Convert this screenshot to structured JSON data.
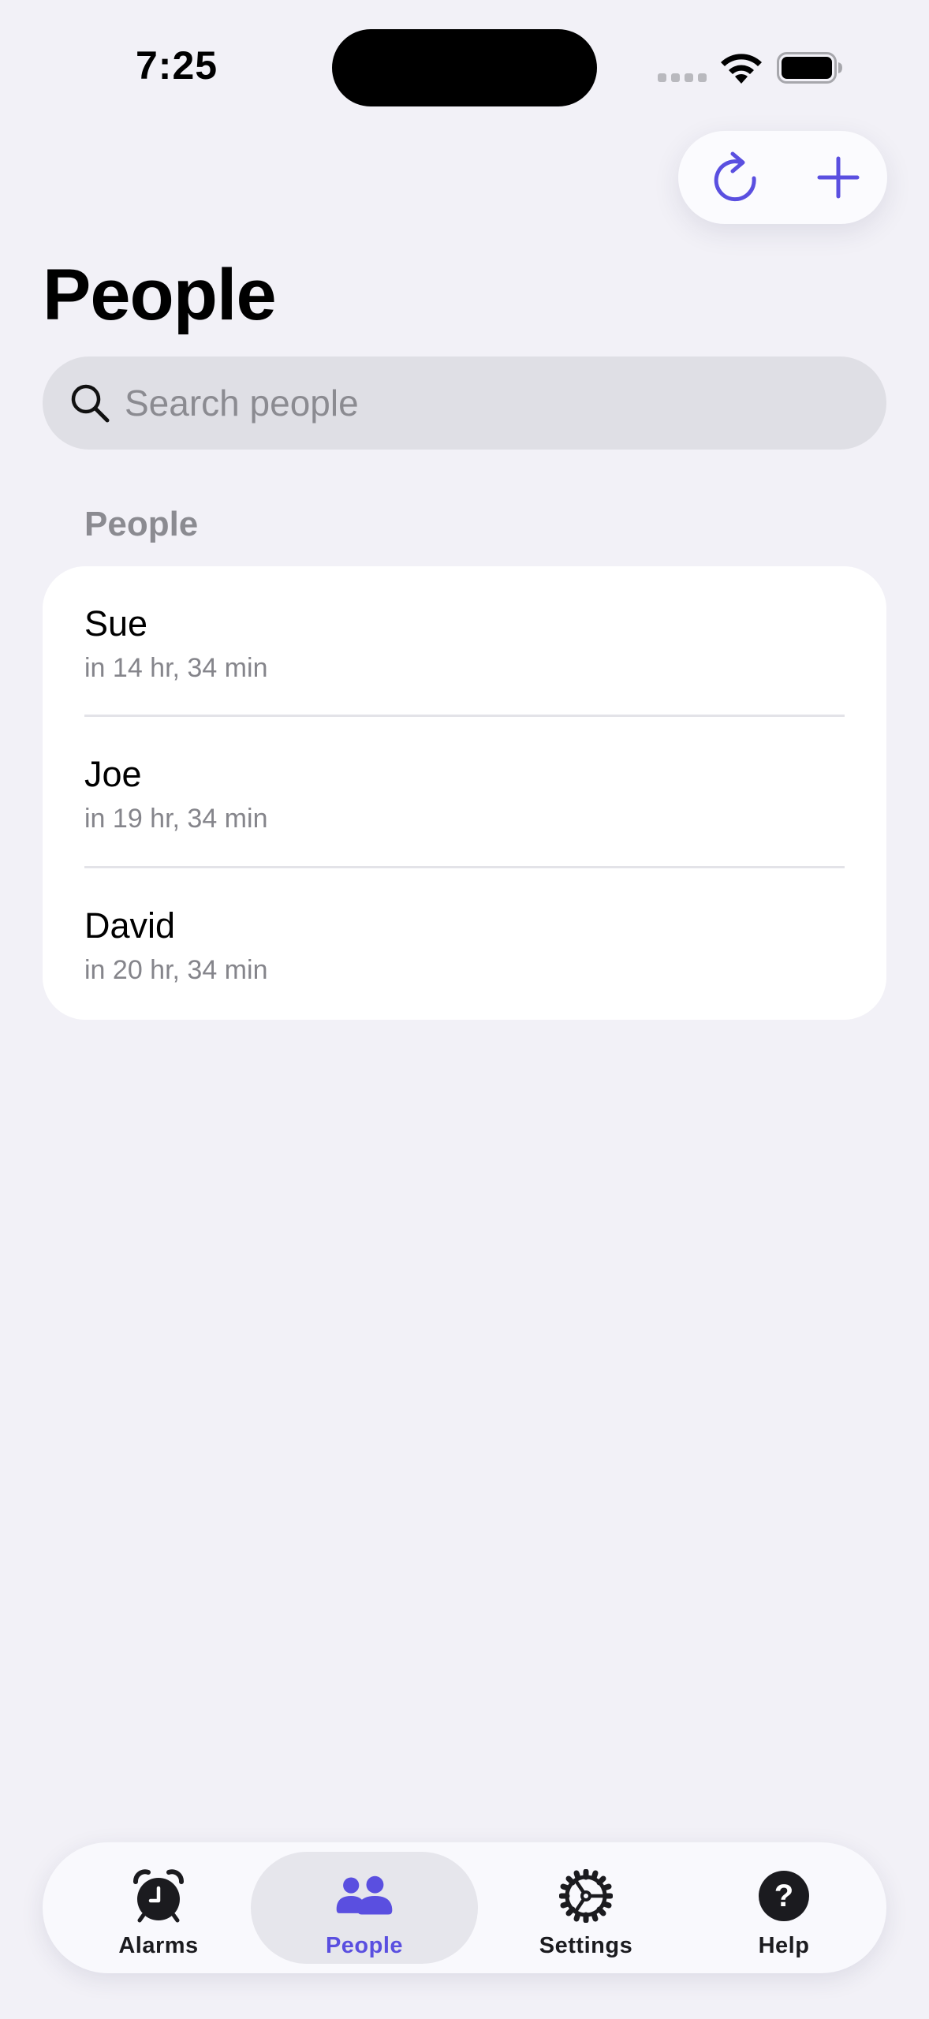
{
  "status_bar": {
    "time": "7:25"
  },
  "colors": {
    "accent": "#5a4fe0",
    "background": "#f2f1f7",
    "card": "#ffffff",
    "secondary_text": "#85858b"
  },
  "toolbar": {
    "refresh_icon": "refresh-icon",
    "add_icon": "plus-icon"
  },
  "page": {
    "title": "People"
  },
  "search": {
    "placeholder": "Search people",
    "value": ""
  },
  "section": {
    "header": "People",
    "items": [
      {
        "name": "Sue",
        "subtitle": "in 14 hr, 34 min"
      },
      {
        "name": "Joe",
        "subtitle": "in 19 hr, 34 min"
      },
      {
        "name": "David",
        "subtitle": "in 20 hr, 34 min"
      }
    ]
  },
  "tab_bar": {
    "selected": "People",
    "tabs": [
      {
        "label": "Alarms",
        "icon": "alarm-clock-icon"
      },
      {
        "label": "People",
        "icon": "people-icon"
      },
      {
        "label": "Settings",
        "icon": "gear-icon"
      },
      {
        "label": "Help",
        "icon": "help-icon"
      }
    ]
  }
}
